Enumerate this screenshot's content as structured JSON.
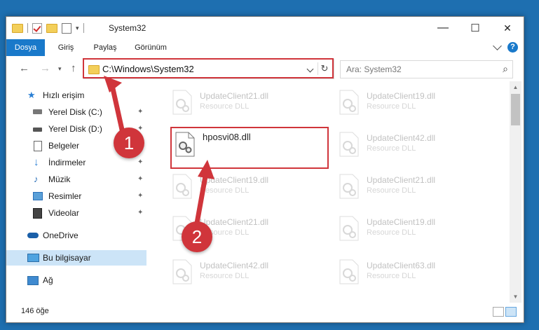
{
  "window": {
    "title": "System32",
    "minimize_glyph": "—",
    "maximize_glyph": "☐",
    "close_glyph": "✕"
  },
  "ribbon": {
    "tabs": [
      "Dosya",
      "Giriş",
      "Paylaş",
      "Görünüm"
    ],
    "help_glyph": "?"
  },
  "nav": {
    "address_path": "C:\\Windows\\System32",
    "search_placeholder": "Ara: System32"
  },
  "sidebar": {
    "items": [
      {
        "label": "Hızlı erişim",
        "icon": "star-icon",
        "pinned": false
      },
      {
        "label": "Yerel Disk (C:)",
        "icon": "drive-icon",
        "pinned": true
      },
      {
        "label": "Yerel Disk (D:)",
        "icon": "drive-icon",
        "pinned": true
      },
      {
        "label": "Belgeler",
        "icon": "documents-icon",
        "pinned": true
      },
      {
        "label": "İndirmeler",
        "icon": "download-icon",
        "pinned": true
      },
      {
        "label": "Müzik",
        "icon": "music-icon",
        "pinned": true
      },
      {
        "label": "Resimler",
        "icon": "pictures-icon",
        "pinned": true
      },
      {
        "label": "Videolar",
        "icon": "videos-icon",
        "pinned": true
      },
      {
        "label": "OneDrive",
        "icon": "onedrive-icon",
        "pinned": false
      },
      {
        "label": "Bu bilgisayar",
        "icon": "computer-icon",
        "pinned": false,
        "selected": true
      },
      {
        "label": "Ağ",
        "icon": "network-icon",
        "pinned": false
      }
    ],
    "pin_glyph": "📌"
  },
  "files": [
    {
      "name": "UpdateClient21.dll",
      "type": "Resource DLL"
    },
    {
      "name": "UpdateClient19.dll",
      "type": "Resource DLL"
    },
    {
      "name": "hposvi08.dll",
      "type": "",
      "highlighted": true
    },
    {
      "name": "UpdateClient42.dll",
      "type": "Resource DLL"
    },
    {
      "name": "UpdateClient19.dll",
      "type": "Resource DLL"
    },
    {
      "name": "UpdateClient21.dll",
      "type": "Resource DLL"
    },
    {
      "name": "UpdateClient21.dll",
      "type": "Resource DLL"
    },
    {
      "name": "UpdateClient19.dll",
      "type": "Resource DLL"
    },
    {
      "name": "UpdateClient42.dll",
      "type": "Resource DLL"
    },
    {
      "name": "UpdateClient63.dll",
      "type": "Resource DLL"
    }
  ],
  "status": {
    "item_count": "146 öğe"
  },
  "annotations": {
    "step1": "1",
    "step2": "2",
    "highlight_color": "#d0353b"
  },
  "colors": {
    "accent": "#1979ca",
    "desktop": "#1e6fb0",
    "selection": "#cce4f7"
  }
}
